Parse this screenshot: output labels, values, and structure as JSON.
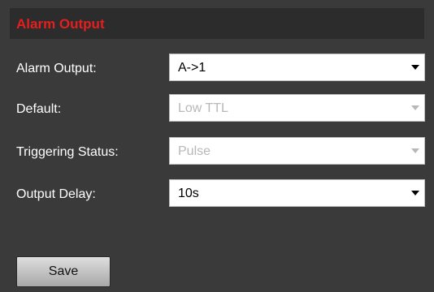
{
  "panel": {
    "title": "Alarm Output"
  },
  "fields": [
    {
      "label": "Alarm Output:",
      "value": "A->1",
      "disabled": false
    },
    {
      "label": "Default:",
      "value": "Low TTL",
      "disabled": true
    },
    {
      "label": "Triggering Status:",
      "value": "Pulse",
      "disabled": true
    },
    {
      "label": "Output Delay:",
      "value": "10s",
      "disabled": false
    }
  ],
  "actions": {
    "save_label": "Save"
  },
  "colors": {
    "title": "#e61e1e",
    "background": "#3a3a3a",
    "titlebar": "#2c2c2c",
    "disabled_text": "#b8b8b8"
  }
}
